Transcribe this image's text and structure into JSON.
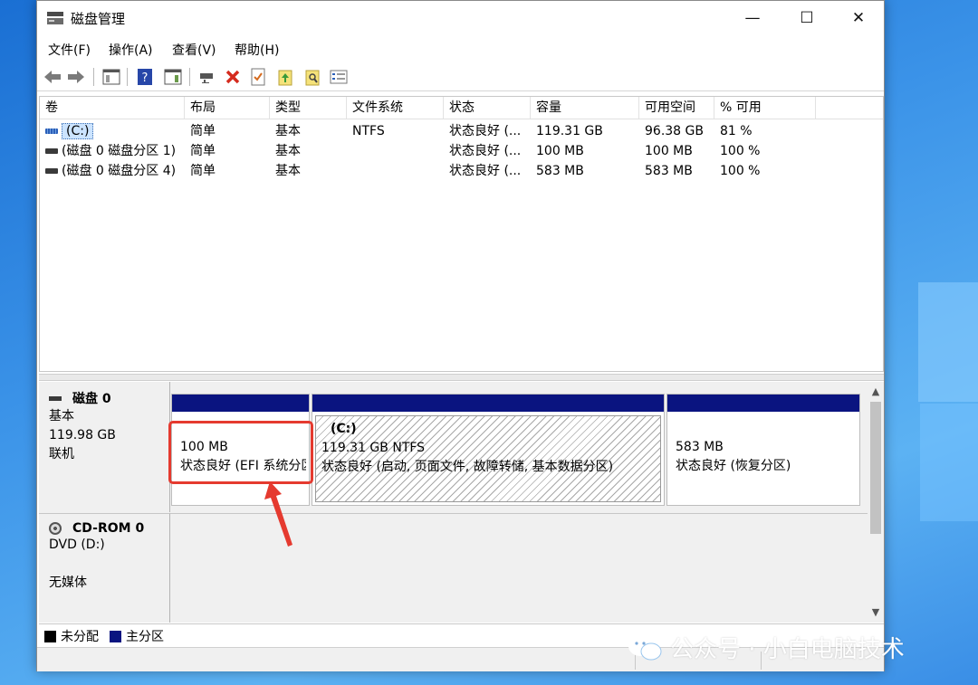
{
  "window": {
    "title": "磁盘管理"
  },
  "window_controls": {
    "minimize": "—",
    "maximize": "☐",
    "close": "✕"
  },
  "menu": [
    "文件(F)",
    "操作(A)",
    "查看(V)",
    "帮助(H)"
  ],
  "toolbar": {
    "icons": [
      "back-icon",
      "forward-icon",
      "show-hide-tree-icon",
      "help-icon",
      "show-hide-action-pane-icon",
      "connect-icon",
      "delete-icon",
      "properties-icon",
      "refresh-icon",
      "find-icon",
      "list-icon"
    ]
  },
  "columns": [
    "卷",
    "布局",
    "类型",
    "文件系统",
    "状态",
    "容量",
    "可用空间",
    "% 可用"
  ],
  "volumes": [
    {
      "name": "(C:)",
      "layout": "简单",
      "type": "基本",
      "fs": "NTFS",
      "status": "状态良好 (...",
      "capacity": "119.31 GB",
      "free": "96.38 GB",
      "pct": "81 %"
    },
    {
      "name": "(磁盘 0 磁盘分区 1)",
      "layout": "简单",
      "type": "基本",
      "fs": "",
      "status": "状态良好 (...",
      "capacity": "100 MB",
      "free": "100 MB",
      "pct": "100 %"
    },
    {
      "name": "(磁盘 0 磁盘分区 4)",
      "layout": "简单",
      "type": "基本",
      "fs": "",
      "status": "状态良好 (...",
      "capacity": "583 MB",
      "free": "583 MB",
      "pct": "100 %"
    }
  ],
  "disk0": {
    "name": "磁盘 0",
    "type": "基本",
    "size": "119.98 GB",
    "state": "联机",
    "partitions": [
      {
        "title": "",
        "size": "100 MB",
        "status": "状态良好 (EFI 系统分区)"
      },
      {
        "title": "(C:)",
        "size": "119.31 GB NTFS",
        "status": "状态良好 (启动, 页面文件, 故障转储, 基本数据分区)"
      },
      {
        "title": "",
        "size": "583 MB",
        "status": "状态良好 (恢复分区)"
      }
    ]
  },
  "cdrom0": {
    "name": "CD-ROM 0",
    "type": "DVD (D:)",
    "state": "无媒体"
  },
  "legend": [
    {
      "label": "未分配",
      "color": "#000000"
    },
    {
      "label": "主分区",
      "color": "#0a1480"
    }
  ],
  "watermark": {
    "text": "公众号 · 小白电脑技术"
  },
  "colors": {
    "partition_bar": "#0a1480",
    "highlight": "#e53a2f"
  }
}
